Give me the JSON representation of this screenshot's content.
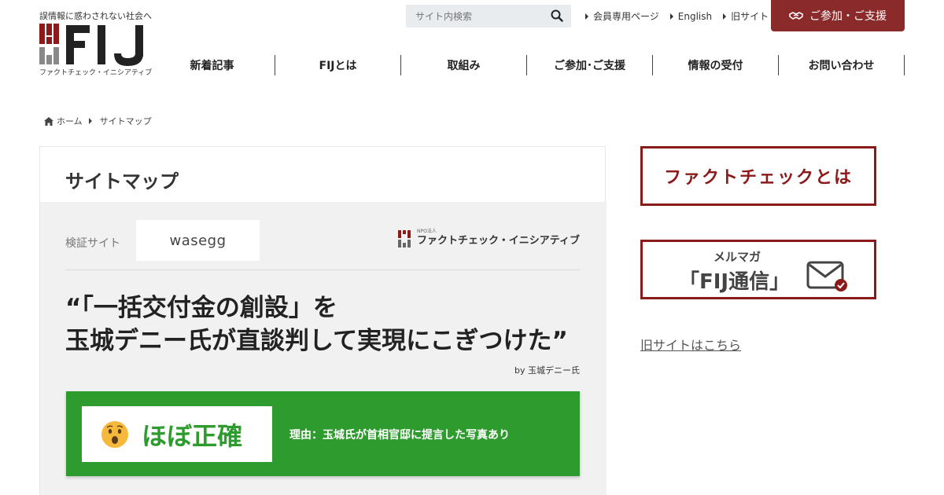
{
  "header": {
    "tagline": "誤情報に惑わされない社会へ",
    "logo_subtitle": "ファクトチェック・イニシアティブ",
    "search_placeholder": "サイト内検索",
    "top_links": [
      "会員専用ページ",
      "English",
      "旧サイト"
    ],
    "support_button": "ご参加・ご支援",
    "nav": [
      "新着記事",
      "FIJとは",
      "取組み",
      "ご参加･ご支援",
      "情報の受付",
      "お問い合わせ"
    ]
  },
  "breadcrumb": {
    "home": "ホーム",
    "current": "サイトマップ"
  },
  "main": {
    "page_title": "サイトマップ",
    "verify_site_label": "検証サイト",
    "verify_site_logo": "wasegg",
    "org_npo": "NPO法人",
    "org_name": "ファクトチェック・イニシアティブ",
    "headline_line1": "“「一括交付金の創設」を",
    "headline_line2": "玉城デニー氏が直談判して実現にこぎつけた”",
    "byline": "by 玉城デニー氏",
    "verdict": "ほぼ正確",
    "verdict_reason": "理由：玉城氏が首相官邸に提言した写真あり"
  },
  "sidebar": {
    "banner1_text": "ファクトチェックとは",
    "banner2_sub": "メルマガ",
    "banner2_main": "「FIJ通信」",
    "old_site_link": "旧サイトはこちら"
  },
  "colors": {
    "brand_red": "#8b2a2a",
    "verdict_green": "#2e9b2e",
    "search_bg": "#e9ecef"
  },
  "icons": [
    "search-icon",
    "handshake-icon",
    "home-icon",
    "surprised-face-icon",
    "mail-check-icon"
  ]
}
